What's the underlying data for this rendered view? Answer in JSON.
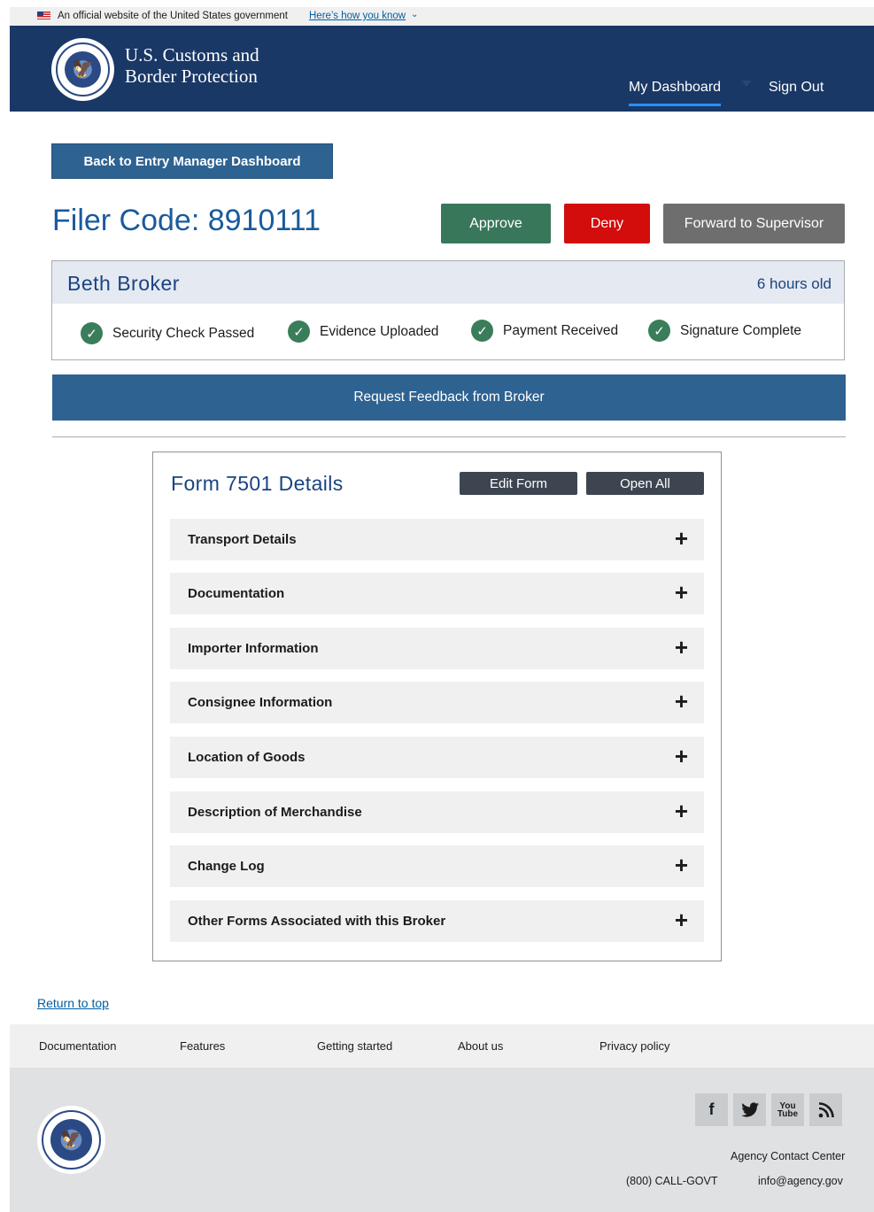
{
  "banner": {
    "official_text": "An official website of the United States government",
    "how_link": "Here’s how you know"
  },
  "header": {
    "org_line1": "U.S. Customs and",
    "org_line2": "Border Protection",
    "nav_dashboard": "My Dashboard",
    "nav_signout": "Sign Out"
  },
  "back_button": "Back to Entry Manager Dashboard",
  "filer_code": "Filer Code: 8910111",
  "actions": {
    "approve": "Approve",
    "deny": "Deny",
    "forward": "Forward to Supervisor"
  },
  "broker": {
    "name": "Beth Broker",
    "age": "6 hours old",
    "checks": [
      "Security Check Passed",
      "Evidence Uploaded",
      "Payment Received",
      "Signature Complete"
    ]
  },
  "feedback_button": "Request Feedback from Broker",
  "form": {
    "title": "Form 7501 Details",
    "edit_button": "Edit Form",
    "open_all_button": "Open All",
    "sections": [
      "Transport Details",
      "Documentation",
      "Importer Information",
      "Consignee Information",
      "Location of Goods",
      "Description of Merchandise",
      "Change Log",
      "Other Forms Associated with this Broker"
    ]
  },
  "return_to_top": "Return to top",
  "footer": {
    "nav": [
      "Documentation",
      "Features",
      "Getting started",
      "About us",
      "Privacy policy"
    ],
    "social_icons": [
      "facebook-icon",
      "twitter-icon",
      "youtube-icon",
      "rss-icon"
    ],
    "contact_title": "Agency Contact Center",
    "phone": "(800) CALL-GOVT",
    "email": "info@agency.gov"
  },
  "colors": {
    "header_bg": "#1a3866",
    "primary_blue": "#2e6291",
    "approve_green": "#39775a",
    "deny_red": "#d30c0c",
    "forward_gray": "#6e6e6e",
    "check_green": "#3a7d5b"
  }
}
